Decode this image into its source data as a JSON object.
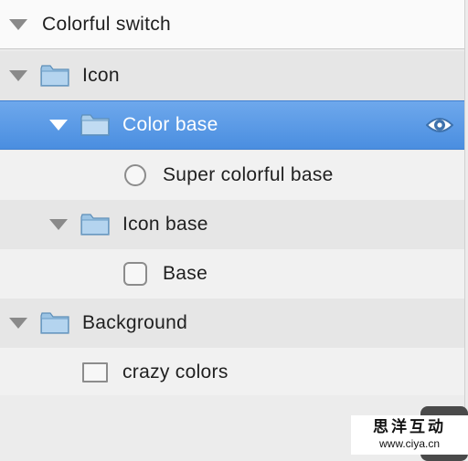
{
  "tree": {
    "rows": [
      {
        "label": "Colorful switch",
        "icon": "disclosure-triangle-icon",
        "expanded": true
      },
      {
        "label": "Icon",
        "icon": "folder-icon",
        "expanded": true
      },
      {
        "label": "Color base",
        "icon": "folder-icon",
        "expanded": true,
        "selected": true,
        "trailing_icon": "eye-icon"
      },
      {
        "label": "Super colorful base",
        "icon": "circle-icon"
      },
      {
        "label": "Icon base",
        "icon": "folder-icon",
        "expanded": true
      },
      {
        "label": "Base",
        "icon": "rounded-square-icon"
      },
      {
        "label": "Background",
        "icon": "folder-icon",
        "expanded": true
      },
      {
        "label": "crazy colors",
        "icon": "rectangle-icon"
      }
    ]
  },
  "watermark": {
    "title": "思洋互动",
    "url": "www.ciya.cn"
  },
  "colors": {
    "selection": "#4a8ee0",
    "folder": "#9cc4e4",
    "background": "#ececec"
  }
}
